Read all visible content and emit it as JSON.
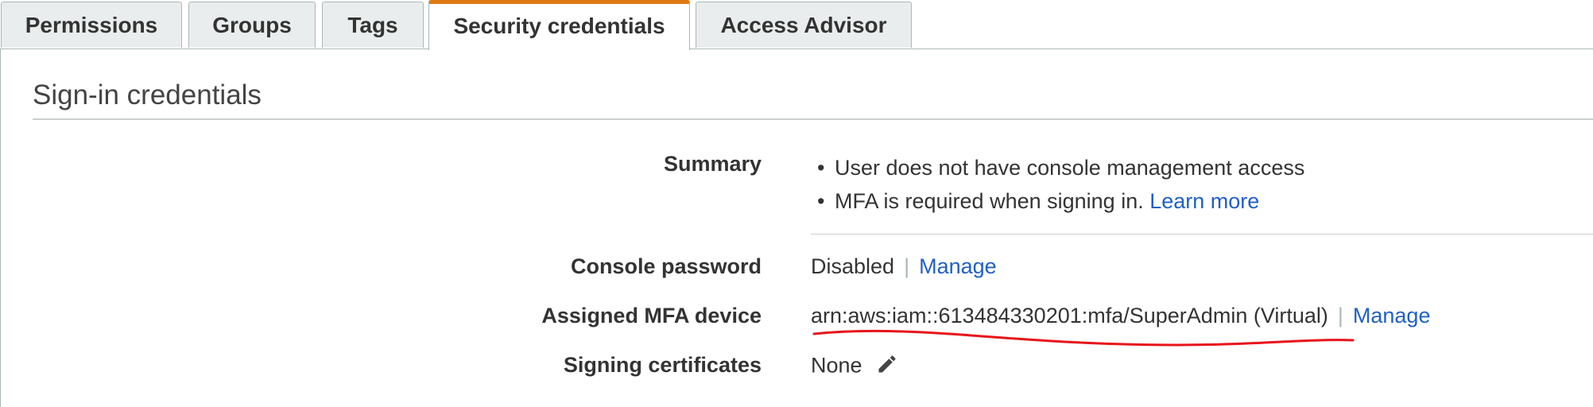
{
  "tabs": [
    {
      "label": "Permissions",
      "active": false
    },
    {
      "label": "Groups",
      "active": false
    },
    {
      "label": "Tags",
      "active": false
    },
    {
      "label": "Security credentials",
      "active": true
    },
    {
      "label": "Access Advisor",
      "active": false
    }
  ],
  "section": {
    "title": "Sign-in credentials"
  },
  "summary": {
    "label": "Summary",
    "items": [
      {
        "text": "User does not have console management access"
      },
      {
        "text": "MFA is required when signing in.",
        "link": "Learn more"
      }
    ]
  },
  "console_password": {
    "label": "Console password",
    "value": "Disabled",
    "separator": "|",
    "action": "Manage"
  },
  "mfa": {
    "label": "Assigned MFA device",
    "value": "arn:aws:iam::613484330201:mfa/SuperAdmin (Virtual)",
    "separator": "|",
    "action": "Manage"
  },
  "signing_certificates": {
    "label": "Signing certificates",
    "value": "None",
    "icon": "pencil-icon"
  },
  "colors": {
    "active_tab_accent": "#e07b14",
    "link": "#2160c4",
    "annotation": "#e8141b"
  },
  "bullet": "•"
}
